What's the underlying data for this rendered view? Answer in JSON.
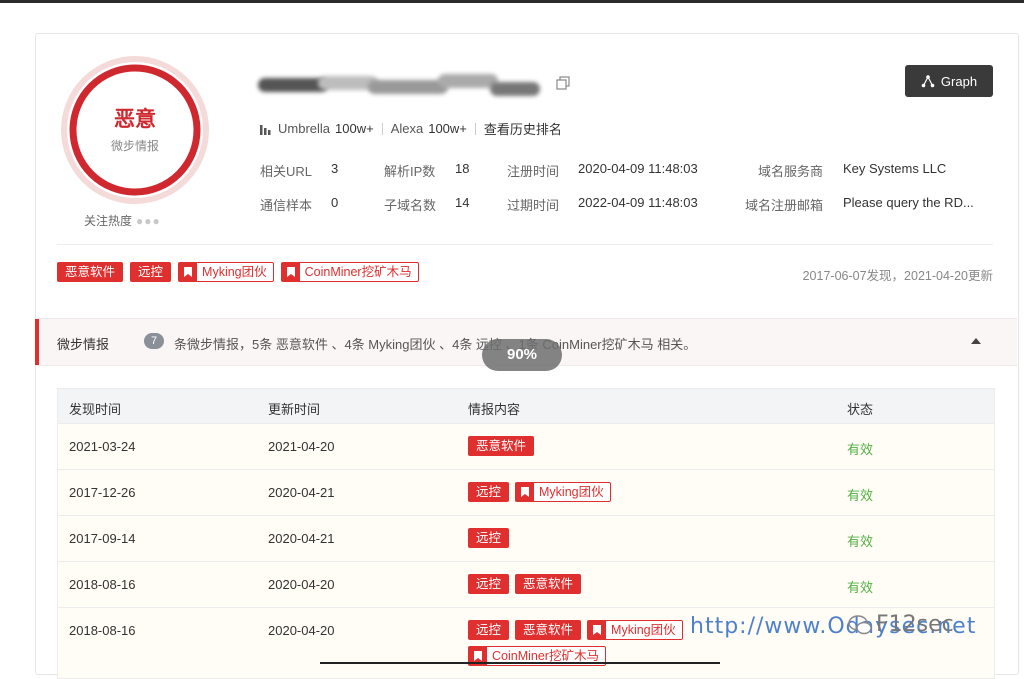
{
  "profile": {
    "verdict": "恶意",
    "verdict_source": "微步情报",
    "heat_label": "关注热度"
  },
  "header": {
    "graph_button": "Graph",
    "umbrella_label": "Umbrella",
    "umbrella_value": "100w+",
    "alexa_label": "Alexa",
    "alexa_value": "100w+",
    "history_link": "查看历史排名"
  },
  "info": [
    {
      "key": "相关URL",
      "value": "3"
    },
    {
      "key": "解析IP数",
      "value": "18"
    },
    {
      "key": "注册时间",
      "value": "2020-04-09 11:48:03"
    },
    {
      "key": "域名服务商",
      "value": "Key Systems LLC"
    },
    {
      "key": "通信样本",
      "value": "0"
    },
    {
      "key": "子域名数",
      "value": "14"
    },
    {
      "key": "过期时间",
      "value": "2022-04-09 11:48:03"
    },
    {
      "key": "域名注册邮箱",
      "value": "Please query the RD..."
    }
  ],
  "tags": [
    {
      "label": "恶意软件",
      "style": "solid"
    },
    {
      "label": "远控",
      "style": "solid"
    },
    {
      "label": "Myking团伙",
      "style": "outline"
    },
    {
      "label": "CoinMiner挖矿木马",
      "style": "outline"
    }
  ],
  "dates_text": "2017-06-07发现，2021-04-20更新",
  "intel": {
    "title": "微步情报",
    "count": "7",
    "summary": "条微步情报，5条 恶意软件 、4条 Myking团伙 、4条 远控 、1条 CoinMiner挖矿木马 相关。",
    "progress": "90%"
  },
  "table": {
    "headers": [
      "发现时间",
      "更新时间",
      "情报内容",
      "状态"
    ],
    "rows": [
      {
        "found": "2021-03-24",
        "updated": "2021-04-20",
        "status": "有效",
        "tags": [
          {
            "label": "恶意软件",
            "style": "solid"
          }
        ]
      },
      {
        "found": "2017-12-26",
        "updated": "2020-04-21",
        "status": "有效",
        "tags": [
          {
            "label": "远控",
            "style": "solid"
          },
          {
            "label": "Myking团伙",
            "style": "outline"
          }
        ]
      },
      {
        "found": "2017-09-14",
        "updated": "2020-04-21",
        "status": "有效",
        "tags": [
          {
            "label": "远控",
            "style": "solid"
          }
        ]
      },
      {
        "found": "2018-08-16",
        "updated": "2020-04-20",
        "status": "有效",
        "tags": [
          {
            "label": "远控",
            "style": "solid"
          },
          {
            "label": "恶意软件",
            "style": "solid"
          }
        ]
      },
      {
        "found": "2018-08-16",
        "updated": "2020-04-20",
        "status": "",
        "tags": [
          {
            "label": "远控",
            "style": "solid"
          },
          {
            "label": "恶意软件",
            "style": "solid"
          },
          {
            "label": "Myking团伙",
            "style": "outline"
          },
          {
            "label": "CoinMiner挖矿木马",
            "style": "outline"
          }
        ]
      }
    ]
  },
  "watermark": {
    "url": "http://www.Odaysec.net",
    "brand": "F12sec"
  }
}
